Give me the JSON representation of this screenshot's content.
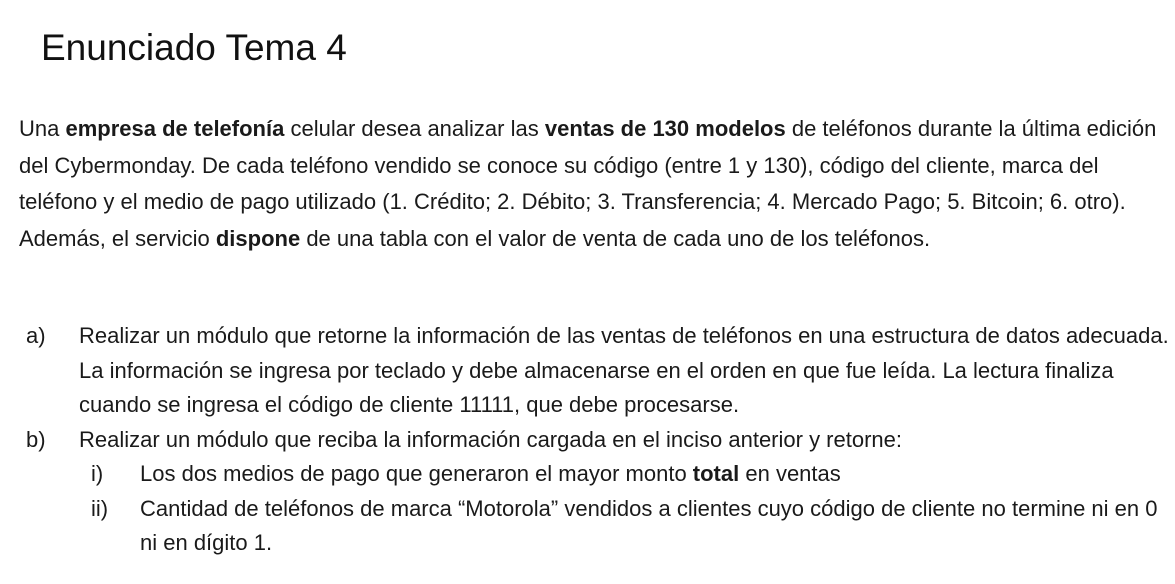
{
  "title": "Enunciado Tema 4",
  "intro": {
    "p1": {
      "t1": "Una ",
      "b1": "empresa de telefonía",
      "t2": " celular desea analizar las ",
      "b2": "ventas de 130 modelos",
      "t3": " de teléfonos durante la última edición del Cybermonday. De cada teléfono vendido se conoce su código (entre 1 y 130), código del cliente, marca del teléfono y el medio de pago utilizado (1. Crédito; 2. Débito; 3. Transferencia; 4. Mercado Pago; 5. Bitcoin; 6. otro)."
    },
    "p2": {
      "t1": "Además, el servicio ",
      "b1": "dispone",
      "t2": " de una tabla con el valor de venta de cada uno de los teléfonos."
    }
  },
  "tasks": {
    "a": {
      "marker": "a)",
      "text": "Realizar un módulo que retorne la información de las ventas de teléfonos en una estructura de datos adecuada. La información se ingresa por teclado y debe almacenarse en el orden en que fue leída. La lectura finaliza cuando se ingresa el código de cliente 11111, que debe procesarse."
    },
    "b": {
      "marker": "b)",
      "text": "Realizar un módulo que reciba la información cargada en el inciso anterior y retorne:",
      "i": {
        "marker": "i)",
        "t1": "Los dos medios de pago que generaron el mayor monto ",
        "b1": "total",
        "t2": " en ventas"
      },
      "ii": {
        "marker": "ii)",
        "text": "Cantidad de teléfonos de marca “Motorola” vendidos a clientes cuyo código de cliente no termine ni en 0 ni en dígito 1."
      }
    }
  }
}
